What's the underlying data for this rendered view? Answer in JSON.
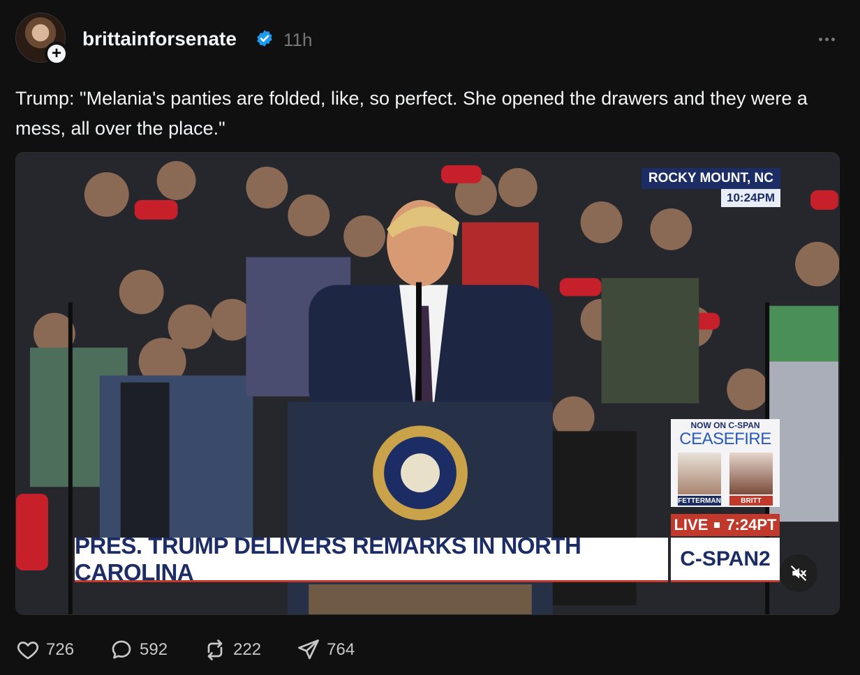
{
  "post": {
    "username": "brittainforsenate",
    "verified": true,
    "time_ago": "11h",
    "text": "Trump: \"Melania's panties are folded, like, so perfect. She opened the drawers and they were a mess, all over the place.\""
  },
  "media": {
    "location": "ROCKY MOUNT, NC",
    "local_time": "10:24PM",
    "chyron": "PRES. TRUMP DELIVERS REMARKS IN NORTH CAROLINA",
    "network": "C-SPAN2",
    "promo": {
      "top_label": "NOW ON C-SPAN",
      "title": "CEASEFIRE",
      "left_name": "FETTERMAN",
      "right_name": "BRITT"
    },
    "live_label": "LIVE",
    "live_time": "7:24PT"
  },
  "actions": {
    "likes": "726",
    "replies": "592",
    "reposts": "222",
    "shares": "764"
  },
  "icons": [
    "plus-icon",
    "verified-badge-icon",
    "more-icon",
    "mute-icon",
    "heart-icon",
    "comment-icon",
    "repost-icon",
    "send-icon"
  ]
}
